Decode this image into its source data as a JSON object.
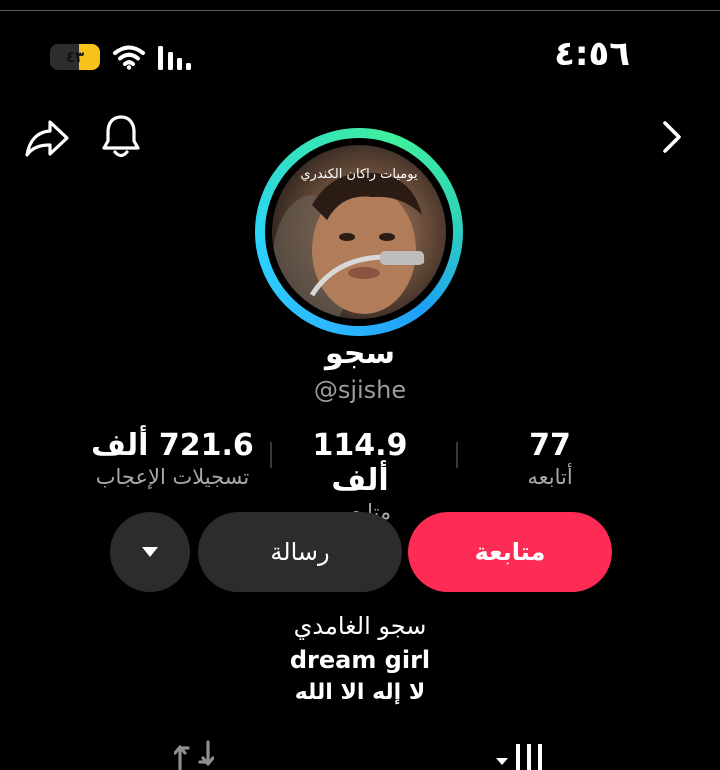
{
  "status_bar": {
    "battery_text": "٤٣",
    "battery_level": 0.43,
    "battery_color": "#f6c21b",
    "time": "٤:٥٦",
    "icons": [
      "wifi-icon",
      "cellular-signal-icon"
    ]
  },
  "toolbar": {
    "icons": [
      "share-icon",
      "notifications-bell-icon",
      "chevron-right-icon"
    ]
  },
  "profile": {
    "avatar_caption": "يوميات راكان الكندري",
    "ring_colors": [
      "#2db9ff",
      "#3ff09c"
    ],
    "display_name": "سجو",
    "username": "@sjishe"
  },
  "stats": {
    "likes": {
      "value": "721.6 ألف",
      "label": "تسجيلات الإعجاب"
    },
    "followers": {
      "value": "114.9 ألف",
      "label": "متابعين"
    },
    "following": {
      "value": "77",
      "label": "أتابعه"
    }
  },
  "actions": {
    "follow_label": "متابعة",
    "follow_color": "#fe2c55",
    "message_label": "رسالة",
    "more_icon": "triangle-down-icon"
  },
  "bio": {
    "line1": "سجو الغامدي",
    "line2": "dream girl",
    "line3": "لا إله الا الله"
  },
  "tabs": {
    "icons": [
      "repost-icon",
      "videos-grid-icon"
    ]
  }
}
